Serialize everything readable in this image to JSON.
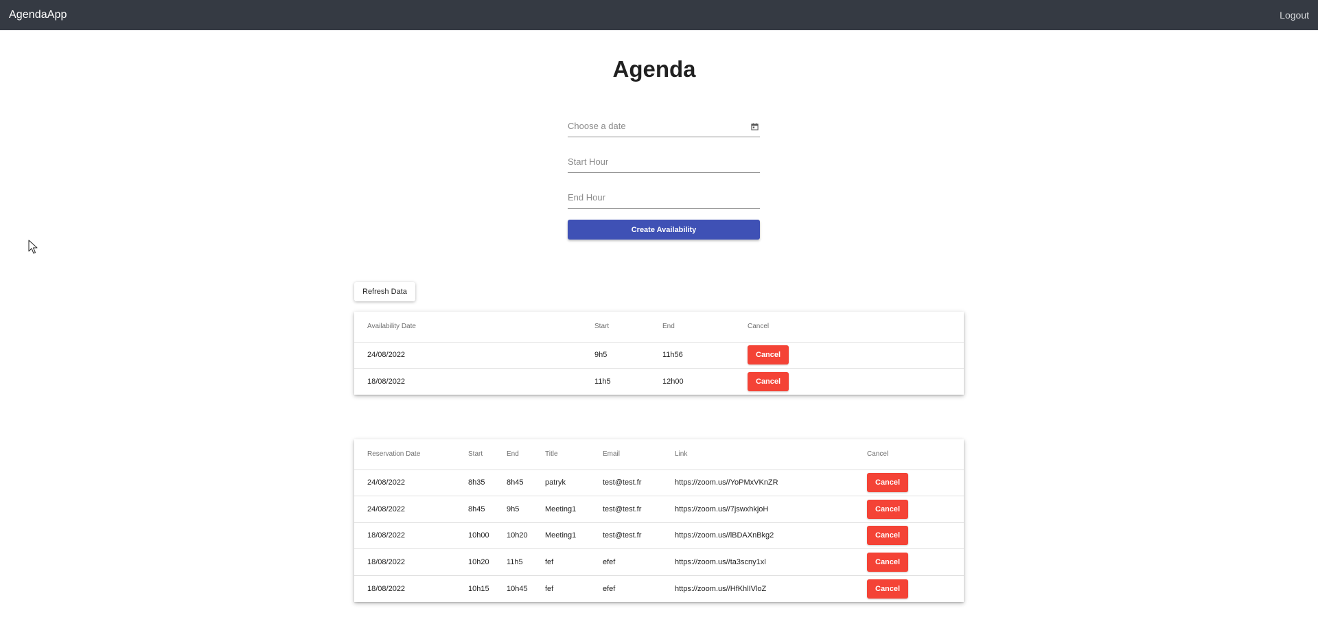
{
  "app": {
    "brand": "AgendaApp",
    "logout_label": "Logout"
  },
  "page": {
    "title": "Agenda"
  },
  "form": {
    "date_placeholder": "Choose a date",
    "start_placeholder": "Start Hour",
    "end_placeholder": "End Hour",
    "create_label": "Create Availability",
    "calendar_icon": "calendar-icon"
  },
  "refresh_label": "Refresh Data",
  "availability": {
    "headers": [
      "Availability Date",
      "Start",
      "End",
      "Cancel"
    ],
    "rows": [
      {
        "date": "24/08/2022",
        "start": "9h5",
        "end": "11h56",
        "cancel": "Cancel"
      },
      {
        "date": "18/08/2022",
        "start": "11h5",
        "end": "12h00",
        "cancel": "Cancel"
      }
    ]
  },
  "reservations": {
    "headers": [
      "Reservation Date",
      "Start",
      "End",
      "Title",
      "Email",
      "Link",
      "Cancel"
    ],
    "rows": [
      {
        "date": "24/08/2022",
        "start": "8h35",
        "end": "8h45",
        "title": "patryk",
        "email": "test@test.fr",
        "link": "https://zoom.us//YoPMxVKnZR",
        "cancel": "Cancel"
      },
      {
        "date": "24/08/2022",
        "start": "8h45",
        "end": "9h5",
        "title": "Meeting1",
        "email": "test@test.fr",
        "link": "https://zoom.us//7jswxhkjoH",
        "cancel": "Cancel"
      },
      {
        "date": "18/08/2022",
        "start": "10h00",
        "end": "10h20",
        "title": "Meeting1",
        "email": "test@test.fr",
        "link": "https://zoom.us//lBDAXnBkg2",
        "cancel": "Cancel"
      },
      {
        "date": "18/08/2022",
        "start": "10h20",
        "end": "11h5",
        "title": "fef",
        "email": "efef",
        "link": "https://zoom.us//ta3scny1xl",
        "cancel": "Cancel"
      },
      {
        "date": "18/08/2022",
        "start": "10h15",
        "end": "10h45",
        "title": "fef",
        "email": "efef",
        "link": "https://zoom.us//HfKhlIVloZ",
        "cancel": "Cancel"
      }
    ]
  },
  "colors": {
    "toolbar": "#353a43",
    "primary": "#3f51b5",
    "warn": "#f44336"
  }
}
